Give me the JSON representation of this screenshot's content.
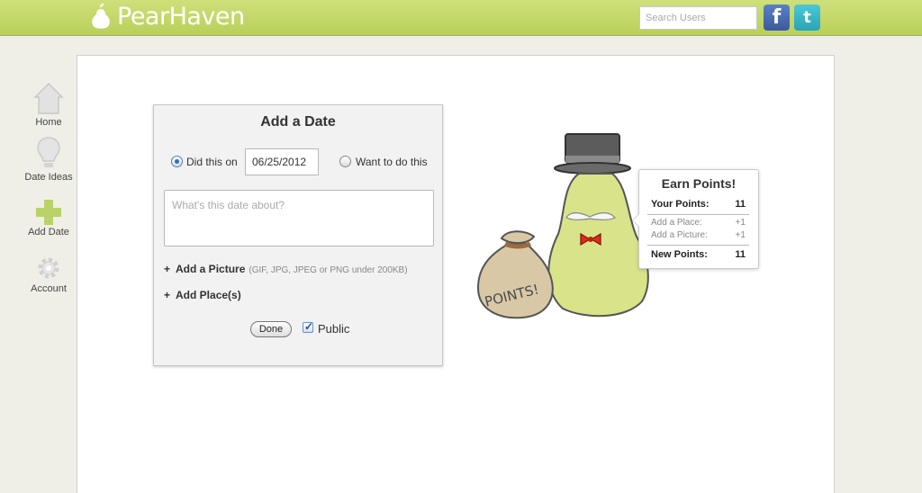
{
  "header": {
    "logo_text": "PearHaven",
    "search_placeholder": "Search Users",
    "facebook_label": "f",
    "twitter_label": "t"
  },
  "nav": {
    "items": [
      {
        "label": "Home",
        "icon": "home-icon"
      },
      {
        "label": "Date Ideas",
        "icon": "lightbulb-icon"
      },
      {
        "label": "Add Date",
        "icon": "plus-icon"
      },
      {
        "label": "Account",
        "icon": "gear-icon"
      }
    ]
  },
  "form": {
    "title": "Add a Date",
    "did_this_label": "Did this on",
    "date_value": "06/25/2012",
    "want_to_label": "Want to do this",
    "description_placeholder": "What's this date about?",
    "add_picture_label": "Add a Picture",
    "add_picture_hint": "(GIF, JPG, JPEG or PNG under 200KB)",
    "add_places_label": "Add Place(s)",
    "done_label": "Done",
    "public_label": "Public",
    "plus": "+"
  },
  "points": {
    "title": "Earn Points!",
    "your_points_label": "Your Points:",
    "your_points_value": "11",
    "add_place_label": "Add a Place:",
    "add_place_value": "+1",
    "add_picture_label": "Add a Picture:",
    "add_picture_value": "+1",
    "new_points_label": "New Points:",
    "new_points_value": "11"
  },
  "illustration": {
    "bag_text": "POINTS!"
  },
  "colors": {
    "header_green": "#c3d86a",
    "pear_green": "#d8e38a",
    "bag_tan": "#d9c8a6",
    "bowtie_red": "#e02a1a"
  }
}
